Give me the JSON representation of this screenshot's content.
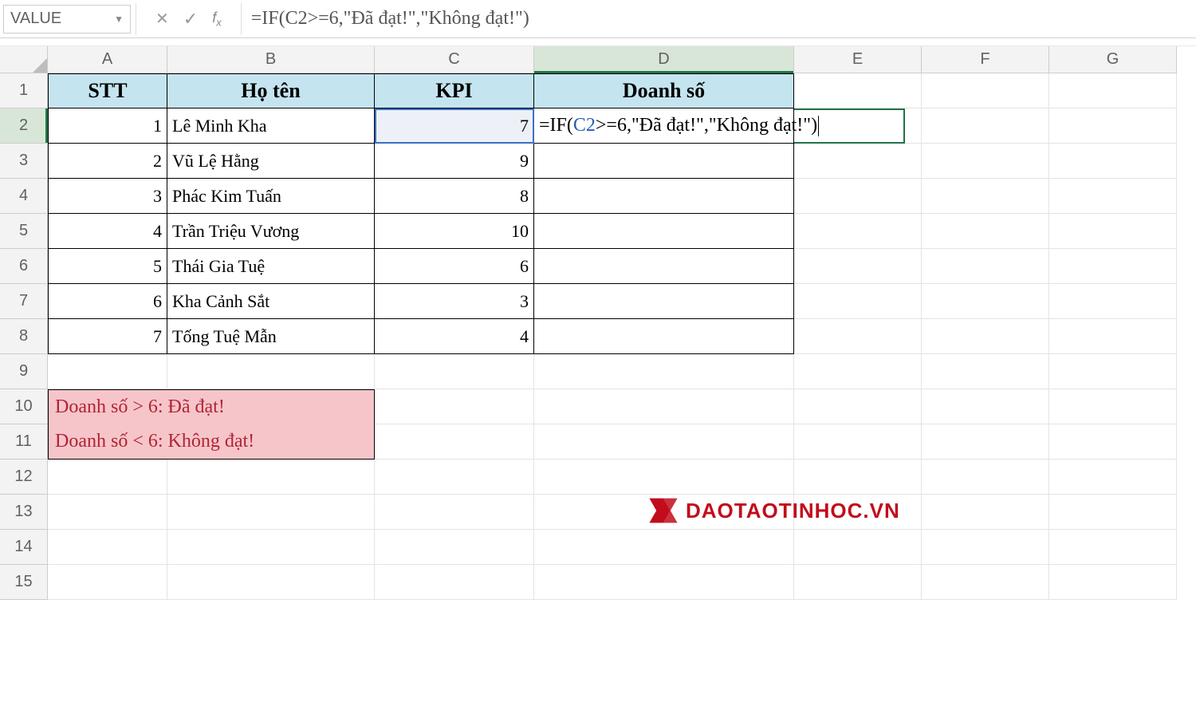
{
  "formula_bar": {
    "name_box": "VALUE",
    "formula": "=IF(C2>=6,\"Đã đạt!\",\"Không đạt!\")"
  },
  "columns": [
    "A",
    "B",
    "C",
    "D",
    "E",
    "F",
    "G"
  ],
  "row_numbers": [
    "1",
    "2",
    "3",
    "4",
    "5",
    "6",
    "7",
    "8",
    "9",
    "10",
    "11",
    "12",
    "13",
    "14",
    "15"
  ],
  "headers": {
    "A": "STT",
    "B": "Họ tên",
    "C": "KPI",
    "D": "Doanh số"
  },
  "rows": [
    {
      "stt": "1",
      "name": "Lê Minh Kha",
      "kpi": "7"
    },
    {
      "stt": "2",
      "name": "Vũ Lệ Hằng",
      "kpi": "9"
    },
    {
      "stt": "3",
      "name": "Phác Kim Tuấn",
      "kpi": "8"
    },
    {
      "stt": "4",
      "name": "Trần Triệu Vương",
      "kpi": "10"
    },
    {
      "stt": "5",
      "name": "Thái Gia Tuệ",
      "kpi": "6"
    },
    {
      "stt": "6",
      "name": "Kha Cảnh Sắt",
      "kpi": "3"
    },
    {
      "stt": "7",
      "name": "Tống Tuệ Mẫn",
      "kpi": "4"
    }
  ],
  "editing": {
    "prefix": "=IF(",
    "ref": "C2",
    "suffix": ">=6,\"Đã đạt!\",\"Không đạt!\")"
  },
  "notes": {
    "line1": "Doanh số > 6: Đã đạt!",
    "line2": "Doanh số < 6: Không đạt!"
  },
  "watermark": "DAOTAOTINHOC.VN"
}
